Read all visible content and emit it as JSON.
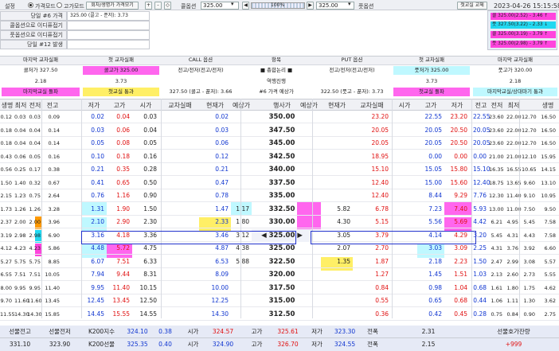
{
  "toolbar": {
    "settings": "설정",
    "radio_price": "가격모드",
    "radio_vol": "고가모드",
    "btn_compare": "회차/생명가 가격모기",
    "plus": "+",
    "minus": "-",
    "diamond": "◇",
    "call_label": "콜옵션",
    "call_value": "325.00",
    "progress": "100%",
    "put_value": "325.00",
    "put_label": "풋옵션",
    "btn_first": "첫교실 교체",
    "datetime": "2023-04-26 15:15:58"
  },
  "left_panel": {
    "rows": [
      "당일 #6 가격",
      "콜옵션으로 이디퓨접기",
      "풋옵션으로 이디퓨접기",
      "당일 #12 발생"
    ],
    "info": "325.00 (콜고 - 푼저): 3.73"
  },
  "right_boxes": [
    "콜 325.00(2.52) - 3.46 ↑",
    "풋 327.50(3.22) - 2.33 ↓",
    "콜 325.00(3.19) - 3.79 ↑",
    "풋 325.00(2.98) - 3.79 ↑"
  ],
  "mid_header": {
    "h1": "마지막 교차실패",
    "h2": "첫 교차실패",
    "h3": "CALL 옵션",
    "h4": "항목",
    "h5": "PUT 옵션",
    "h6": "첫 교차실패",
    "h7": "마지막 교차실패",
    "r1": [
      "콜저가 327.50",
      "콜고가 325.00",
      "전고/전저(전고/전저)",
      "■ 총합논리 ■",
      "전고/전저(전고/전저)",
      "풋저가 325.00",
      "풋고가 320.00"
    ],
    "r2": [
      "2.18",
      "3.73",
      "",
      "역행진행",
      "",
      "3.73",
      "2.18"
    ],
    "r3": [
      "마지막교실 돌파",
      "첫교실 통과",
      "327.50 (콜고 - 푼저): 3.66",
      "#6 가격 예상가",
      "322.50 (풋고 - 푼저): 3.73",
      "첫교실 돌파",
      "마지막교실/상대마기 통과"
    ]
  },
  "col_headers": [
    "생명",
    "최저",
    "전저",
    "전고",
    "저가",
    "고가",
    "시가",
    "교차실패",
    "현재가",
    "예상가",
    "행사가",
    "예상가",
    "현재가",
    "교차실패",
    "시가",
    "고가",
    "저가",
    "전고",
    "전저",
    "최저",
    "생명"
  ],
  "rows": [
    {
      "s": "350.00",
      "c": [
        "0.12",
        "0.03",
        "0.03",
        "0.09",
        "0.02",
        "0.04",
        "0.03",
        "",
        "0.02",
        "",
        "",
        "",
        "23.20",
        "",
        "22.55",
        "23.20",
        "22.55",
        "23.60",
        "22.00",
        "12.70",
        "16.50"
      ]
    },
    {
      "s": "347.50",
      "c": [
        "0.18",
        "0.04",
        "0.04",
        "0.14",
        "0.03",
        "0.06",
        "0.04",
        "",
        "0.03",
        "",
        "",
        "",
        "20.05",
        "",
        "20.05",
        "20.50",
        "20.05",
        "23.60",
        "22.00",
        "12.70",
        "16.50"
      ]
    },
    {
      "s": "345.00",
      "c": [
        "0.18",
        "0.04",
        "0.04",
        "0.14",
        "0.05",
        "0.08",
        "0.05",
        "",
        "0.06",
        "",
        "",
        "",
        "20.05",
        "",
        "20.05",
        "20.50",
        "20.05",
        "23.60",
        "22.00",
        "12.70",
        "16.50"
      ]
    },
    {
      "s": "342.50",
      "c": [
        "0.43",
        "0.06",
        "0.05",
        "0.16",
        "0.10",
        "0.18",
        "0.16",
        "",
        "0.12",
        "",
        "",
        "",
        "18.95",
        "",
        "0.00",
        "0.00",
        "0.00",
        "21.00",
        "21.00",
        "12.10",
        "15.95"
      ]
    },
    {
      "s": "340.00",
      "c": [
        "0.56",
        "0.25",
        "0.17",
        "0.38",
        "0.21",
        "0.35",
        "0.28",
        "",
        "0.21",
        "",
        "",
        "",
        "15.10",
        "",
        "15.05",
        "15.80",
        "15.10",
        "16.35",
        "16.55",
        "10.65",
        "14.15"
      ]
    },
    {
      "s": "337.50",
      "c": [
        "1.50",
        "1.40",
        "0.32",
        "0.67",
        "0.41",
        "0.65",
        "0.50",
        "",
        "0.47",
        "",
        "",
        "",
        "12.40",
        "",
        "15.00",
        "15.60",
        "12.40",
        "18.75",
        "13.65",
        "9.60",
        "13.10"
      ]
    },
    {
      "s": "335.00",
      "c": [
        "2.15",
        "1.23",
        "0.75",
        "2.64",
        "0.76",
        "1.16",
        "0.90",
        "",
        "0.78",
        "",
        "",
        "",
        "12.40",
        "",
        "8.44",
        "9.29",
        "7.76",
        "12.30",
        "11.40",
        "9.10",
        "10.95"
      ]
    },
    {
      "s": "332.50",
      "c": [
        "1.73",
        "1.26",
        "1.26",
        "3.28",
        "1.31",
        "1.90",
        "1.50",
        "",
        "1.47",
        "1.17",
        "",
        "5.82",
        "6.78",
        "",
        "7.23",
        "7.40",
        "5.93",
        "13.00",
        "11.00",
        "7.50",
        "9.50"
      ]
    },
    {
      "s": "330.00",
      "c": [
        "2.37",
        "2.00",
        "2.00",
        "3.96",
        "2.10",
        "2.90",
        "2.30",
        "",
        "2.33",
        "1.80",
        "",
        "4.30",
        "5.15",
        "",
        "5.56",
        "5.69",
        "4.42",
        "6.21",
        "4.95",
        "5.45",
        "7.58"
      ]
    },
    {
      "s": "327.50",
      "c": [
        "3.19",
        "2.98",
        "2.98",
        "6.90",
        "3.16",
        "4.18",
        "3.36",
        "",
        "3.46",
        "3.12",
        "",
        "3.05",
        "3.79",
        "",
        "4.14",
        "4.29",
        "3.20",
        "5.45",
        "4.31",
        "4.43",
        "7.58"
      ]
    },
    {
      "s": "325.00",
      "c": [
        "4.12",
        "4.23",
        "4.23",
        "5.86",
        "4.48",
        "5.72",
        "4.75",
        "",
        "4.87",
        "4.38",
        "",
        "2.07",
        "2.70",
        "",
        "3.03",
        "3.09",
        "2.25",
        "4.31",
        "3.76",
        "3.92",
        "6.60"
      ]
    },
    {
      "s": "322.50",
      "c": [
        "5.27",
        "5.75",
        "5.75",
        "8.85",
        "6.07",
        "7.51",
        "6.33",
        "",
        "6.53",
        "5.88",
        "",
        "1.35",
        "1.87",
        "",
        "2.18",
        "2.23",
        "1.50",
        "2.47",
        "2.99",
        "3.08",
        "5.57"
      ]
    },
    {
      "s": "320.00",
      "c": [
        "6.55",
        "7.51",
        "7.51",
        "10.05",
        "7.94",
        "9.44",
        "8.31",
        "",
        "8.09",
        "",
        "",
        "",
        "1.27",
        "",
        "1.45",
        "1.51",
        "1.03",
        "2.13",
        "2.60",
        "2.73",
        "5.55"
      ]
    },
    {
      "s": "317.50",
      "c": [
        "8.00",
        "9.95",
        "9.95",
        "11.40",
        "9.95",
        "11.40",
        "10.15",
        "",
        "10.00",
        "",
        "",
        "",
        "0.84",
        "",
        "0.98",
        "1.04",
        "0.68",
        "1.61",
        "1.80",
        "1.75",
        "4.62"
      ]
    },
    {
      "s": "315.00",
      "c": [
        "9.70",
        "11.60",
        "11.60",
        "13.45",
        "12.45",
        "13.45",
        "12.50",
        "",
        "12.25",
        "",
        "",
        "",
        "0.55",
        "",
        "0.65",
        "0.68",
        "0.44",
        "1.06",
        "1.11",
        "1.30",
        "3.62"
      ]
    },
    {
      "s": "312.50",
      "c": [
        "11.55",
        "14.30",
        "14.30",
        "15.85",
        "14.45",
        "15.55",
        "14.55",
        "",
        "14.30",
        "",
        "",
        "",
        "0.36",
        "",
        "0.42",
        "0.45",
        "0.28",
        "0.75",
        "0.84",
        "0.90",
        "2.75"
      ]
    }
  ],
  "atm_strike": "◀ 325.00 ▶",
  "bottom": {
    "r1": [
      "선물전고",
      "선물전저",
      "K200지수",
      "324.10",
      "0.38",
      "시가",
      "324.57",
      "고가",
      "325.61",
      "저가",
      "323.30",
      "전폭",
      "2.31",
      "선물호가잔량"
    ],
    "r2": [
      "331.10",
      "323.90",
      "K200선물",
      "325.35",
      "0.40",
      "시가",
      "324.90",
      "고가",
      "326.70",
      "저가",
      "324.55",
      "전폭",
      "2.15",
      "+999"
    ]
  },
  "colors": {
    "pink": "#ff66ee",
    "cyan": "#bff8ff",
    "yellow": "#ffef66",
    "red": "#e01010",
    "blue": "#1036d0"
  }
}
